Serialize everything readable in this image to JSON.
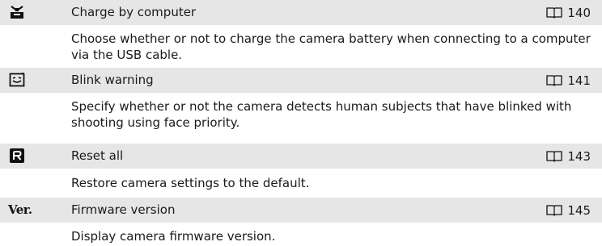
{
  "entries": [
    {
      "icon": "charge-by-computer-icon",
      "title": "Charge by computer",
      "page": "140",
      "description": "Choose whether or not to charge the camera battery when connecting to a computer via the USB cable."
    },
    {
      "icon": "blink-warning-icon",
      "title": "Blink warning",
      "page": "141",
      "description": "Specify whether or not the camera detects human subjects that have blinked with shooting using face priority."
    },
    {
      "icon": "reset-all-icon",
      "title": "Reset all",
      "page": "143",
      "description": "Restore camera settings to the default."
    },
    {
      "icon": "firmware-version-icon",
      "icon_text": "Ver.",
      "title": "Firmware version",
      "page": "145",
      "description": "Display camera firmware version."
    }
  ],
  "colors": {
    "header_background": "#e6e6e6",
    "text": "#1a1a1a"
  }
}
